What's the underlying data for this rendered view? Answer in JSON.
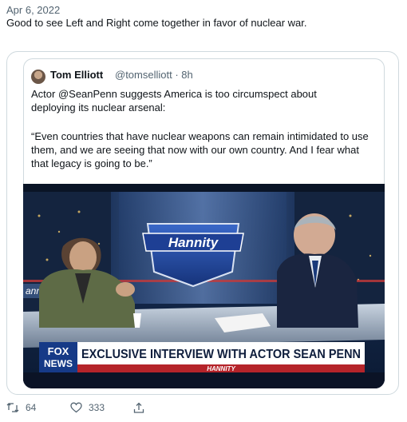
{
  "tweet": {
    "date": "Apr 6, 2022",
    "text": "Good to see Left and Right come together in favor of nuclear war."
  },
  "quoted": {
    "author_name": "Tom Elliott",
    "author_meta": "@tomselliott · 8h",
    "line1": "Actor @SeanPenn suggests America is too circumspect about",
    "line2": "deploying its nuclear arsenal:",
    "quote": "“Even countries that have nuclear weapons can remain intimidated to use them, and we are seeing that now with our own country. And I fear what that legacy is going to be.”"
  },
  "media": {
    "show_logo": "Hannity",
    "network_top": "FOX",
    "network_bottom": "NEWS",
    "chyron": "EXCLUSIVE INTERVIEW WITH ACTOR SEAN PENN",
    "chyron_sub": "HANNITY",
    "side_logo": "annity"
  },
  "actions": {
    "retweets": "64",
    "likes": "333"
  },
  "icons": [
    "retweet-icon",
    "heart-icon",
    "share-icon"
  ]
}
